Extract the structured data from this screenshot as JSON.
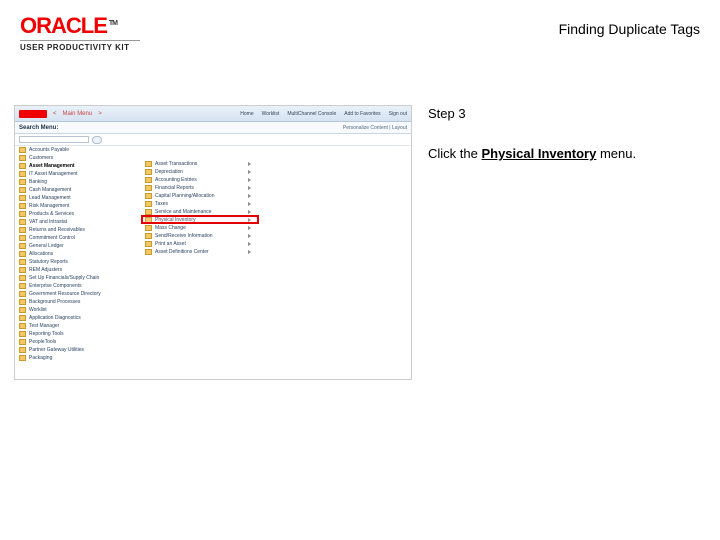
{
  "header": {
    "brand": "ORACLE",
    "tm": "TM",
    "kit": "USER PRODUCTIVITY KIT",
    "title": "Finding Duplicate Tags"
  },
  "instructions": {
    "step_label": "Step 3",
    "prefix": "Click the ",
    "menu_name": "Physical Inventory",
    "suffix": " menu."
  },
  "app": {
    "crumb1": "<",
    "crumb2": "Main Menu",
    "crumb3": ">",
    "top_actions": [
      "Home",
      "Worklist",
      "MultiChannel Console",
      "Add to Favorites",
      "Sign out"
    ],
    "search_label": "Search Menu:",
    "personalize": "Personalize Content | Layout"
  },
  "tree": [
    "Accounts Payable",
    "Customers",
    "Asset Management",
    "IT Asset Management",
    "Banking",
    "Cash Management",
    "Lead Management",
    "Risk Management",
    "Products & Services",
    "VAT and Intrastat",
    "Returns and Receivables",
    "Commitment Control",
    "General Ledger",
    "Allocations",
    "Statutory Reports",
    "REM Adjusters",
    "Set Up Financials/Supply Chain",
    "Enterprise Components",
    "Government Resource Directory",
    "Background Processes",
    "Worklist",
    "Application Diagnostics",
    "Test Manager",
    "Reporting Tools",
    "PeopleTools",
    "Partner Gateway Utilities",
    "Packaging"
  ],
  "tree_bold_index": 2,
  "subtree": [
    "Asset Transactions",
    "Depreciation",
    "Accounting Entries",
    "Financial Reports",
    "Capital Planning/Allocation",
    "Taxes",
    "Service and Maintenance",
    "Physical Inventory",
    "Mass Change",
    "Send/Receive Information",
    "Print an Asset",
    "Asset Definitions Center"
  ],
  "highlight_index": 7
}
